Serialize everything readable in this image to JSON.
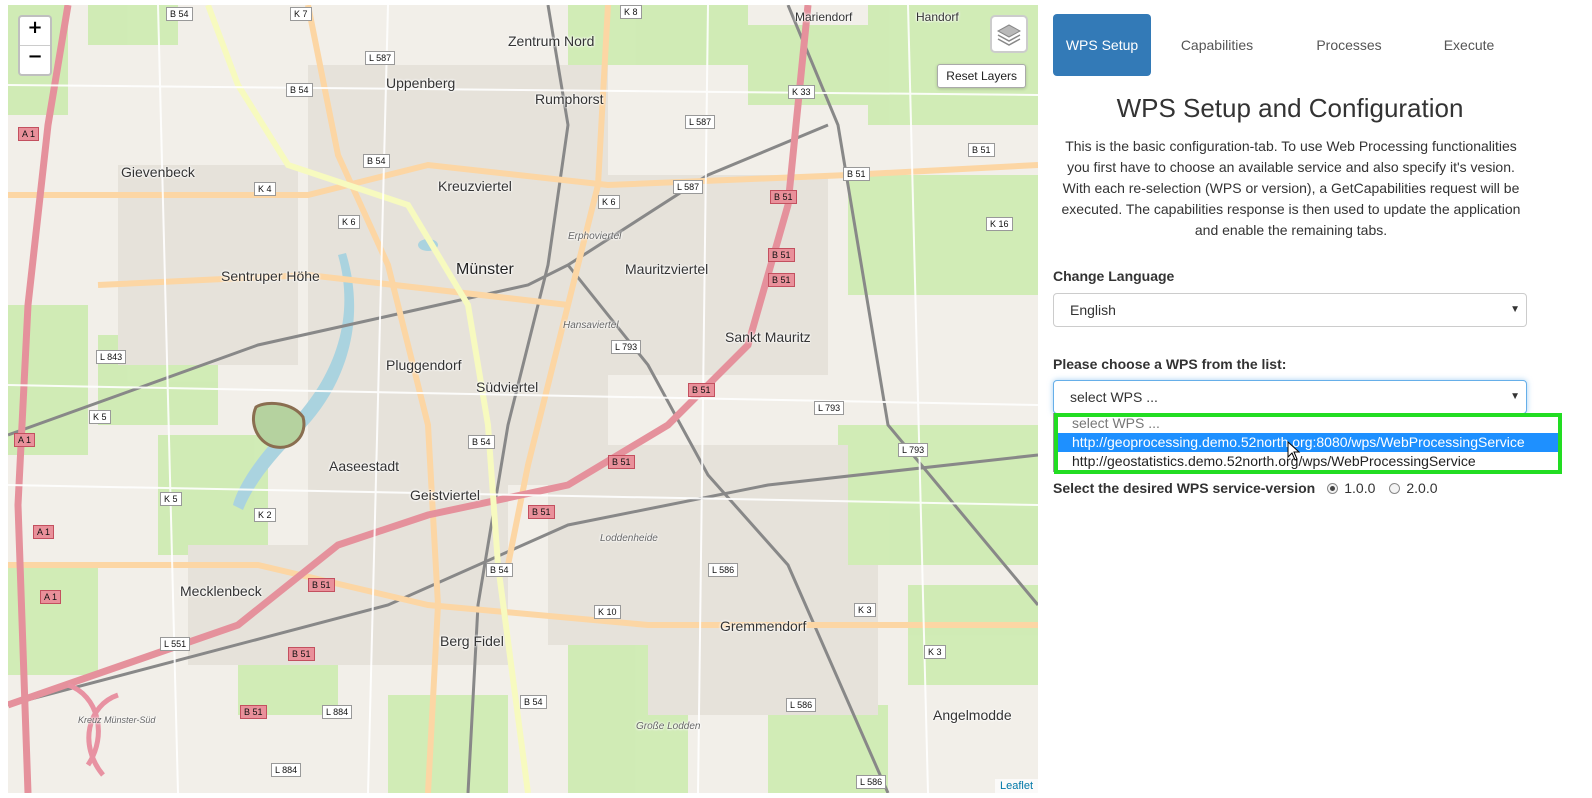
{
  "map": {
    "zoom_in": "+",
    "zoom_out": "−",
    "reset_layers": "Reset Layers",
    "attribution": "Leaflet",
    "labels": {
      "muenster": "Münster",
      "uppenberg": "Uppenberg",
      "zentrum_nord": "Zentrum Nord",
      "rumphorst": "Rumphorst",
      "kreuzviertel": "Kreuzviertel",
      "gievenbeck": "Gievenbeck",
      "sentruper_hoehe": "Sentruper Höhe",
      "mauritzviertel": "Mauritzviertel",
      "sankt_mauritz": "Sankt Mauritz",
      "pluggendorf": "Pluggendorf",
      "suedviertel": "Südviertel",
      "aaseestadt": "Aaseestadt",
      "geistviertel": "Geistviertel",
      "mecklenbeck": "Mecklenbeck",
      "berg_fidel": "Berg Fidel",
      "gremmendorf": "Gremmendorf",
      "angelmodde": "Angelmodde",
      "mariendorf": "Mariendorf",
      "handorf": "Handorf",
      "erphoviertel": "Erphoviertel",
      "hansaviertel": "Hansaviertel",
      "loddenheide": "Loddenheide",
      "kreuz_muenster_sued": "Kreuz Münster-Süd",
      "grosse_lodden": "Große Lodden"
    },
    "road_shields": {
      "b54": "B 54",
      "b51": "B 51",
      "k7": "K 7",
      "k8": "K 8",
      "l587": "L 587",
      "a1": "A 1",
      "k4": "K 4",
      "k6": "K 6",
      "k33": "K 33",
      "k16": "K 16",
      "l843": "L 843",
      "k5": "K 5",
      "k2": "K 2",
      "l793": "L 793",
      "l551": "L 551",
      "l884": "L 884",
      "l586": "L 586",
      "k10": "K 10",
      "k3": "K 3"
    }
  },
  "tabs": [
    "WPS Setup",
    "Capabilities",
    "Processes",
    "Execute"
  ],
  "panel": {
    "title": "WPS Setup and Configuration",
    "description": "This is the basic configuration-tab. To use Web Processing functionalities you first have to choose an available service and also specify it's vesion. With each re-selection (WPS or version), a GetCapabilities request will be executed. The capabilities response is then used to update the application and enable the remaining tabs.",
    "language_label": "Change Language",
    "language_value": "English",
    "wps_label": "Please choose a WPS from the list:",
    "wps_value": "select WPS ...",
    "wps_options": [
      "select WPS ...",
      "http://geoprocessing.demo.52north.org:8080/wps/WebProcessingService",
      "http://geostatistics.demo.52north.org/wps/WebProcessingService"
    ],
    "selected_option_index": 1,
    "version_label": "Select the desired WPS service-version",
    "versions": [
      "1.0.0",
      "2.0.0"
    ],
    "selected_version": "1.0.0"
  },
  "colors": {
    "tab_active": "#337ab7",
    "highlight": "#22dd22",
    "option_selected": "#1e90ff"
  }
}
